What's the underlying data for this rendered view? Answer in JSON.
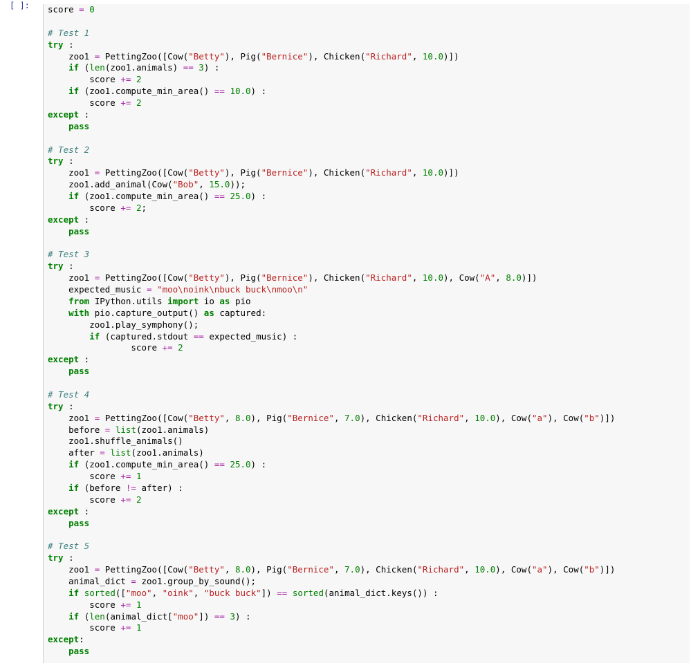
{
  "prompt": "[ ]:",
  "code_lines": [
    [
      [
        "pl",
        "score "
      ],
      [
        "op",
        "="
      ],
      [
        "pl",
        " "
      ],
      [
        "num",
        "0"
      ]
    ],
    [],
    [
      [
        "cmt",
        "# Test 1"
      ]
    ],
    [
      [
        "kw",
        "try"
      ],
      [
        "pl",
        " :"
      ]
    ],
    [
      [
        "pl",
        "    zoo1 "
      ],
      [
        "op",
        "="
      ],
      [
        "pl",
        " PettingZoo([Cow("
      ],
      [
        "str",
        "\"Betty\""
      ],
      [
        "pl",
        "), Pig("
      ],
      [
        "str",
        "\"Bernice\""
      ],
      [
        "pl",
        "), Chicken("
      ],
      [
        "str",
        "\"Richard\""
      ],
      [
        "pl",
        ", "
      ],
      [
        "num",
        "10.0"
      ],
      [
        "pl",
        ")])"
      ]
    ],
    [
      [
        "pl",
        "    "
      ],
      [
        "kw",
        "if"
      ],
      [
        "pl",
        " ("
      ],
      [
        "bi",
        "len"
      ],
      [
        "pl",
        "(zoo1.animals) "
      ],
      [
        "op",
        "=="
      ],
      [
        "pl",
        " "
      ],
      [
        "num",
        "3"
      ],
      [
        "pl",
        ") :"
      ]
    ],
    [
      [
        "pl",
        "        score "
      ],
      [
        "op",
        "+="
      ],
      [
        "pl",
        " "
      ],
      [
        "num",
        "2"
      ]
    ],
    [
      [
        "pl",
        "    "
      ],
      [
        "kw",
        "if"
      ],
      [
        "pl",
        " (zoo1.compute_min_area() "
      ],
      [
        "op",
        "=="
      ],
      [
        "pl",
        " "
      ],
      [
        "num",
        "10.0"
      ],
      [
        "pl",
        ") :"
      ]
    ],
    [
      [
        "pl",
        "        score "
      ],
      [
        "op",
        "+="
      ],
      [
        "pl",
        " "
      ],
      [
        "num",
        "2"
      ]
    ],
    [
      [
        "kw",
        "except"
      ],
      [
        "pl",
        " :"
      ]
    ],
    [
      [
        "pl",
        "    "
      ],
      [
        "kw",
        "pass"
      ]
    ],
    [],
    [
      [
        "cmt",
        "# Test 2"
      ]
    ],
    [
      [
        "kw",
        "try"
      ],
      [
        "pl",
        " :"
      ]
    ],
    [
      [
        "pl",
        "    zoo1 "
      ],
      [
        "op",
        "="
      ],
      [
        "pl",
        " PettingZoo([Cow("
      ],
      [
        "str",
        "\"Betty\""
      ],
      [
        "pl",
        "), Pig("
      ],
      [
        "str",
        "\"Bernice\""
      ],
      [
        "pl",
        "), Chicken("
      ],
      [
        "str",
        "\"Richard\""
      ],
      [
        "pl",
        ", "
      ],
      [
        "num",
        "10.0"
      ],
      [
        "pl",
        ")])"
      ]
    ],
    [
      [
        "pl",
        "    zoo1.add_animal(Cow("
      ],
      [
        "str",
        "\"Bob\""
      ],
      [
        "pl",
        ", "
      ],
      [
        "num",
        "15.0"
      ],
      [
        "pl",
        "));"
      ]
    ],
    [
      [
        "pl",
        "    "
      ],
      [
        "kw",
        "if"
      ],
      [
        "pl",
        " (zoo1.compute_min_area() "
      ],
      [
        "op",
        "=="
      ],
      [
        "pl",
        " "
      ],
      [
        "num",
        "25.0"
      ],
      [
        "pl",
        ") :"
      ]
    ],
    [
      [
        "pl",
        "        score "
      ],
      [
        "op",
        "+="
      ],
      [
        "pl",
        " "
      ],
      [
        "num",
        "2"
      ],
      [
        "pl",
        ";"
      ]
    ],
    [
      [
        "kw",
        "except"
      ],
      [
        "pl",
        " :"
      ]
    ],
    [
      [
        "pl",
        "    "
      ],
      [
        "kw",
        "pass"
      ]
    ],
    [],
    [
      [
        "cmt",
        "# Test 3"
      ]
    ],
    [
      [
        "kw",
        "try"
      ],
      [
        "pl",
        " :"
      ]
    ],
    [
      [
        "pl",
        "    zoo1 "
      ],
      [
        "op",
        "="
      ],
      [
        "pl",
        " PettingZoo([Cow("
      ],
      [
        "str",
        "\"Betty\""
      ],
      [
        "pl",
        "), Pig("
      ],
      [
        "str",
        "\"Bernice\""
      ],
      [
        "pl",
        "), Chicken("
      ],
      [
        "str",
        "\"Richard\""
      ],
      [
        "pl",
        ", "
      ],
      [
        "num",
        "10.0"
      ],
      [
        "pl",
        "), Cow("
      ],
      [
        "str",
        "\"A\""
      ],
      [
        "pl",
        ", "
      ],
      [
        "num",
        "8.0"
      ],
      [
        "pl",
        ")])"
      ]
    ],
    [
      [
        "pl",
        "    expected_music "
      ],
      [
        "op",
        "="
      ],
      [
        "pl",
        " "
      ],
      [
        "str",
        "\"moo\\noink\\nbuck buck\\nmoo\\n\""
      ]
    ],
    [
      [
        "pl",
        "    "
      ],
      [
        "kw",
        "from"
      ],
      [
        "pl",
        " IPython.utils "
      ],
      [
        "kw",
        "import"
      ],
      [
        "pl",
        " io "
      ],
      [
        "kw",
        "as"
      ],
      [
        "pl",
        " pio"
      ]
    ],
    [
      [
        "pl",
        "    "
      ],
      [
        "kw",
        "with"
      ],
      [
        "pl",
        " pio.capture_output() "
      ],
      [
        "kw",
        "as"
      ],
      [
        "pl",
        " captured:"
      ]
    ],
    [
      [
        "pl",
        "        zoo1.play_symphony();"
      ]
    ],
    [
      [
        "pl",
        "        "
      ],
      [
        "kw",
        "if"
      ],
      [
        "pl",
        " (captured.stdout "
      ],
      [
        "op",
        "=="
      ],
      [
        "pl",
        " expected_music) :"
      ]
    ],
    [
      [
        "pl",
        "                score "
      ],
      [
        "op",
        "+="
      ],
      [
        "pl",
        " "
      ],
      [
        "num",
        "2"
      ]
    ],
    [
      [
        "kw",
        "except"
      ],
      [
        "pl",
        " :"
      ]
    ],
    [
      [
        "pl",
        "    "
      ],
      [
        "kw",
        "pass"
      ]
    ],
    [],
    [
      [
        "cmt",
        "# Test 4"
      ]
    ],
    [
      [
        "kw",
        "try"
      ],
      [
        "pl",
        " :"
      ]
    ],
    [
      [
        "pl",
        "    zoo1 "
      ],
      [
        "op",
        "="
      ],
      [
        "pl",
        " PettingZoo([Cow("
      ],
      [
        "str",
        "\"Betty\""
      ],
      [
        "pl",
        ", "
      ],
      [
        "num",
        "8.0"
      ],
      [
        "pl",
        "), Pig("
      ],
      [
        "str",
        "\"Bernice\""
      ],
      [
        "pl",
        ", "
      ],
      [
        "num",
        "7.0"
      ],
      [
        "pl",
        "), Chicken("
      ],
      [
        "str",
        "\"Richard\""
      ],
      [
        "pl",
        ", "
      ],
      [
        "num",
        "10.0"
      ],
      [
        "pl",
        "), Cow("
      ],
      [
        "str",
        "\"a\""
      ],
      [
        "pl",
        "), Cow("
      ],
      [
        "str",
        "\"b\""
      ],
      [
        "pl",
        ")])"
      ]
    ],
    [
      [
        "pl",
        "    before "
      ],
      [
        "op",
        "="
      ],
      [
        "pl",
        " "
      ],
      [
        "bi",
        "list"
      ],
      [
        "pl",
        "(zoo1.animals)"
      ]
    ],
    [
      [
        "pl",
        "    zoo1.shuffle_animals()"
      ]
    ],
    [
      [
        "pl",
        "    after "
      ],
      [
        "op",
        "="
      ],
      [
        "pl",
        " "
      ],
      [
        "bi",
        "list"
      ],
      [
        "pl",
        "(zoo1.animals)"
      ]
    ],
    [
      [
        "pl",
        "    "
      ],
      [
        "kw",
        "if"
      ],
      [
        "pl",
        " (zoo1.compute_min_area() "
      ],
      [
        "op",
        "=="
      ],
      [
        "pl",
        " "
      ],
      [
        "num",
        "25.0"
      ],
      [
        "pl",
        ") :"
      ]
    ],
    [
      [
        "pl",
        "        score "
      ],
      [
        "op",
        "+="
      ],
      [
        "pl",
        " "
      ],
      [
        "num",
        "1"
      ]
    ],
    [
      [
        "pl",
        "    "
      ],
      [
        "kw",
        "if"
      ],
      [
        "pl",
        " (before "
      ],
      [
        "op",
        "!="
      ],
      [
        "pl",
        " after) :"
      ]
    ],
    [
      [
        "pl",
        "        score "
      ],
      [
        "op",
        "+="
      ],
      [
        "pl",
        " "
      ],
      [
        "num",
        "2"
      ]
    ],
    [
      [
        "kw",
        "except"
      ],
      [
        "pl",
        " :"
      ]
    ],
    [
      [
        "pl",
        "    "
      ],
      [
        "kw",
        "pass"
      ]
    ],
    [],
    [
      [
        "cmt",
        "# Test 5"
      ]
    ],
    [
      [
        "kw",
        "try"
      ],
      [
        "pl",
        " :"
      ]
    ],
    [
      [
        "pl",
        "    zoo1 "
      ],
      [
        "op",
        "="
      ],
      [
        "pl",
        " PettingZoo([Cow("
      ],
      [
        "str",
        "\"Betty\""
      ],
      [
        "pl",
        ", "
      ],
      [
        "num",
        "8.0"
      ],
      [
        "pl",
        "), Pig("
      ],
      [
        "str",
        "\"Bernice\""
      ],
      [
        "pl",
        ", "
      ],
      [
        "num",
        "7.0"
      ],
      [
        "pl",
        "), Chicken("
      ],
      [
        "str",
        "\"Richard\""
      ],
      [
        "pl",
        ", "
      ],
      [
        "num",
        "10.0"
      ],
      [
        "pl",
        "), Cow("
      ],
      [
        "str",
        "\"a\""
      ],
      [
        "pl",
        "), Cow("
      ],
      [
        "str",
        "\"b\""
      ],
      [
        "pl",
        ")])"
      ]
    ],
    [
      [
        "pl",
        "    animal_dict "
      ],
      [
        "op",
        "="
      ],
      [
        "pl",
        " zoo1.group_by_sound();"
      ]
    ],
    [
      [
        "pl",
        "    "
      ],
      [
        "kw",
        "if"
      ],
      [
        "pl",
        " "
      ],
      [
        "bi",
        "sorted"
      ],
      [
        "pl",
        "(["
      ],
      [
        "str",
        "\"moo\""
      ],
      [
        "pl",
        ", "
      ],
      [
        "str",
        "\"oink\""
      ],
      [
        "pl",
        ", "
      ],
      [
        "str",
        "\"buck buck\""
      ],
      [
        "pl",
        "]) "
      ],
      [
        "op",
        "=="
      ],
      [
        "pl",
        " "
      ],
      [
        "bi",
        "sorted"
      ],
      [
        "pl",
        "(animal_dict.keys()) :"
      ]
    ],
    [
      [
        "pl",
        "        score "
      ],
      [
        "op",
        "+="
      ],
      [
        "pl",
        " "
      ],
      [
        "num",
        "1"
      ]
    ],
    [
      [
        "pl",
        "    "
      ],
      [
        "kw",
        "if"
      ],
      [
        "pl",
        " ("
      ],
      [
        "bi",
        "len"
      ],
      [
        "pl",
        "(animal_dict["
      ],
      [
        "str",
        "\"moo\""
      ],
      [
        "pl",
        "]) "
      ],
      [
        "op",
        "=="
      ],
      [
        "pl",
        " "
      ],
      [
        "num",
        "3"
      ],
      [
        "pl",
        ") :"
      ]
    ],
    [
      [
        "pl",
        "        score "
      ],
      [
        "op",
        "+="
      ],
      [
        "pl",
        " "
      ],
      [
        "num",
        "1"
      ]
    ],
    [
      [
        "kw",
        "except"
      ],
      [
        "pl",
        ":"
      ]
    ],
    [
      [
        "pl",
        "    "
      ],
      [
        "kw",
        "pass"
      ]
    ]
  ]
}
